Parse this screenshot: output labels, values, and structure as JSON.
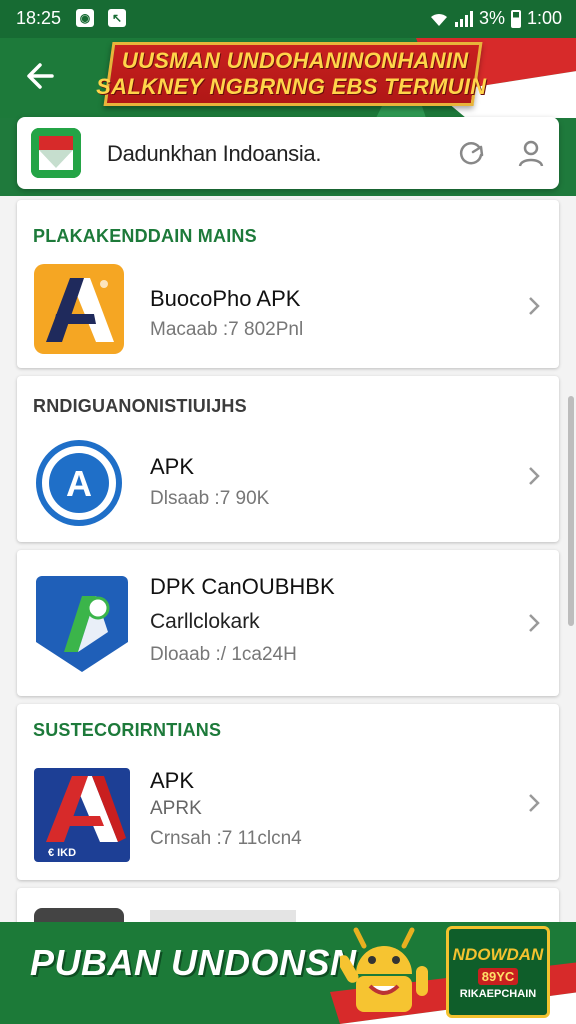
{
  "status_bar": {
    "time": "18:25",
    "battery_text": "3%",
    "clock_right": "1:00"
  },
  "header": {
    "banner_line1": "UUSMAN UNDOHANINONHANIN",
    "banner_line2": "SALKNEY NGBRNNG EBS TERMUIN"
  },
  "search": {
    "text": "Dadunkhan Indoansia."
  },
  "sections": [
    {
      "title": "PLAKAKENDDAIN MAINS",
      "apps": [
        {
          "name": "BuocoPho APK",
          "sub": "Macaab :7 802Pnl"
        }
      ]
    },
    {
      "title": "RNDIGUANONISTIUIJHS",
      "apps": [
        {
          "name": "APK",
          "sub": "Dlsaab :7 90K"
        }
      ]
    },
    {
      "title": "",
      "apps": [
        {
          "name": "DPK CanOUBHBK",
          "sub": "Carllclokark",
          "sub2": "Dloaab :/ 1ca24H"
        }
      ]
    },
    {
      "title": "SUSTECORIRNTIANS",
      "apps": [
        {
          "name": "APK",
          "sub": "APRK",
          "sub2": "Crnsah :7 11clcn4"
        }
      ]
    }
  ],
  "bottom_banner": {
    "title": "PUBAN UNDONSN",
    "badge_line1": "NDOWDAN",
    "badge_line2": "89YC",
    "badge_line3": "RIKAEPCHAIN"
  },
  "colors": {
    "primary_green": "#1d7a3a",
    "accent_red": "#c8201f",
    "accent_gold": "#f3c22f"
  }
}
